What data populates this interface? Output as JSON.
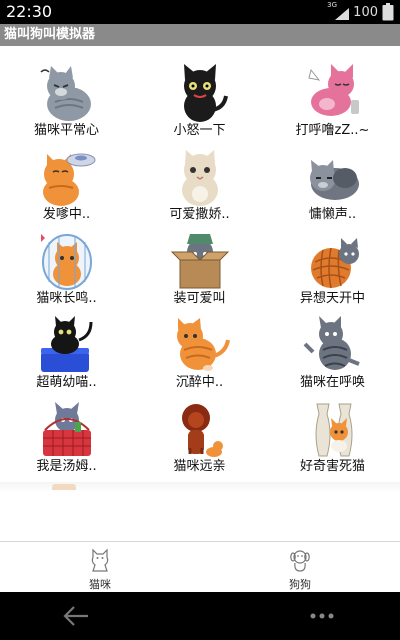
{
  "status_bar": {
    "time": "22:30",
    "network": "3G",
    "battery": "100"
  },
  "title_bar": {
    "title": "猫叫狗叫模拟器"
  },
  "grid": {
    "items": [
      {
        "label": "猫咪平常心",
        "icon": "calm-cat-icon"
      },
      {
        "label": "小怒一下",
        "icon": "angry-black-cat-icon"
      },
      {
        "label": "打呼噜zZ..~",
        "icon": "snoring-pink-cat-icon"
      },
      {
        "label": "发嗲中..",
        "icon": "orange-cat-fish-bowl-icon"
      },
      {
        "label": "可爱撒娇..",
        "icon": "cream-cat-icon"
      },
      {
        "label": "慵懒声..",
        "icon": "lazy-gray-cat-icon"
      },
      {
        "label": "猫咪长鸣..",
        "icon": "caged-cat-icon"
      },
      {
        "label": "装可爱叫",
        "icon": "boxed-cat-icon"
      },
      {
        "label": "异想天开中",
        "icon": "yarn-ball-cat-icon"
      },
      {
        "label": "超萌幼喵..",
        "icon": "litter-box-cat-icon"
      },
      {
        "label": "沉醉中..",
        "icon": "tumbling-orange-cat-icon"
      },
      {
        "label": "猫咪在呼唤",
        "icon": "striped-calling-cat-icon"
      },
      {
        "label": "我是汤姆..",
        "icon": "basket-cat-icon"
      },
      {
        "label": "猫咪远亲",
        "icon": "lion-icon"
      },
      {
        "label": "好奇害死猫",
        "icon": "curious-cat-vase-icon"
      }
    ]
  },
  "tabs": [
    {
      "label": "猫咪",
      "icon": "cat-tab-icon",
      "selected": true
    },
    {
      "label": "狗狗",
      "icon": "dog-tab-icon",
      "selected": false
    }
  ],
  "nav": {
    "back_icon": "back-arrow-icon",
    "more_icon": "more-dots-icon"
  },
  "colors": {
    "status_bar": "#000000",
    "title_bar": "#8a8a8a",
    "background": "#ffffff",
    "nav_bar": "#000000"
  }
}
